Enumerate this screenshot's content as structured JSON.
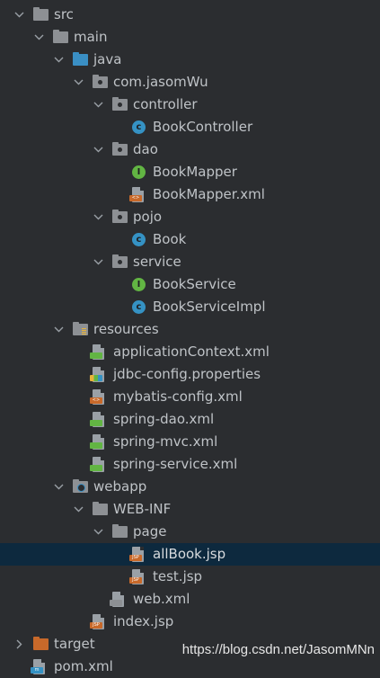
{
  "tree": [
    {
      "label": "src",
      "indent": 0,
      "arrow": "down",
      "icon": "folder-plain",
      "name": "src"
    },
    {
      "label": "main",
      "indent": 1,
      "arrow": "down",
      "icon": "folder-plain",
      "name": "main"
    },
    {
      "label": "java",
      "indent": 2,
      "arrow": "down",
      "icon": "folder-blue",
      "name": "java"
    },
    {
      "label": "com.jasomWu",
      "indent": 3,
      "arrow": "down",
      "icon": "package",
      "name": "com-jasomwu"
    },
    {
      "label": "controller",
      "indent": 4,
      "arrow": "down",
      "icon": "package",
      "name": "controller"
    },
    {
      "label": "BookController",
      "indent": 5,
      "arrow": "",
      "icon": "class",
      "name": "bookcontroller"
    },
    {
      "label": "dao",
      "indent": 4,
      "arrow": "down",
      "icon": "package",
      "name": "dao"
    },
    {
      "label": "BookMapper",
      "indent": 5,
      "arrow": "",
      "icon": "interface",
      "name": "bookmapper"
    },
    {
      "label": "BookMapper.xml",
      "indent": 5,
      "arrow": "",
      "icon": "xml",
      "name": "bookmapper-xml"
    },
    {
      "label": "pojo",
      "indent": 4,
      "arrow": "down",
      "icon": "package",
      "name": "pojo"
    },
    {
      "label": "Book",
      "indent": 5,
      "arrow": "",
      "icon": "class",
      "name": "book"
    },
    {
      "label": "service",
      "indent": 4,
      "arrow": "down",
      "icon": "package",
      "name": "service"
    },
    {
      "label": "BookService",
      "indent": 5,
      "arrow": "",
      "icon": "interface",
      "name": "bookservice"
    },
    {
      "label": "BookServiceImpl",
      "indent": 5,
      "arrow": "",
      "icon": "class",
      "name": "bookserviceimpl"
    },
    {
      "label": "resources",
      "indent": 2,
      "arrow": "down",
      "icon": "resources",
      "name": "resources"
    },
    {
      "label": "applicationContext.xml",
      "indent": 3,
      "arrow": "",
      "icon": "spring-xml",
      "name": "applicationcontext-xml"
    },
    {
      "label": "jdbc-config.properties",
      "indent": 3,
      "arrow": "",
      "icon": "properties",
      "name": "jdbc-config-properties"
    },
    {
      "label": "mybatis-config.xml",
      "indent": 3,
      "arrow": "",
      "icon": "xml",
      "name": "mybatis-config-xml"
    },
    {
      "label": "spring-dao.xml",
      "indent": 3,
      "arrow": "",
      "icon": "spring-xml",
      "name": "spring-dao-xml"
    },
    {
      "label": "spring-mvc.xml",
      "indent": 3,
      "arrow": "",
      "icon": "spring-xml",
      "name": "spring-mvc-xml"
    },
    {
      "label": "spring-service.xml",
      "indent": 3,
      "arrow": "",
      "icon": "spring-xml",
      "name": "spring-service-xml"
    },
    {
      "label": "webapp",
      "indent": 2,
      "arrow": "down",
      "icon": "webapp",
      "name": "webapp"
    },
    {
      "label": "WEB-INF",
      "indent": 3,
      "arrow": "down",
      "icon": "folder-plain",
      "name": "web-inf"
    },
    {
      "label": "page",
      "indent": 4,
      "arrow": "down",
      "icon": "folder-plain",
      "name": "page"
    },
    {
      "label": "allBook.jsp",
      "indent": 5,
      "arrow": "",
      "icon": "jsp",
      "name": "allbook-jsp",
      "selected": true
    },
    {
      "label": "test.jsp",
      "indent": 5,
      "arrow": "",
      "icon": "jsp",
      "name": "test-jsp"
    },
    {
      "label": "web.xml",
      "indent": 4,
      "arrow": "",
      "icon": "web-xml",
      "name": "web-xml"
    },
    {
      "label": "index.jsp",
      "indent": 3,
      "arrow": "",
      "icon": "jsp",
      "name": "index-jsp"
    },
    {
      "label": "target",
      "indent": 0,
      "arrow": "right",
      "icon": "folder-orange",
      "name": "target"
    },
    {
      "label": "pom.xml",
      "indent": 0,
      "arrow": "",
      "icon": "maven",
      "name": "pom-xml"
    }
  ],
  "watermark": "https://blog.csdn.net/JasomMNn",
  "colors": {
    "background": "#2b2d30",
    "selection": "#0d293e",
    "text": "#bfc3c7",
    "class": "#3592c4",
    "interface": "#62b543",
    "source_folder": "#3a8fc4",
    "excluded_folder": "#c8692a"
  }
}
